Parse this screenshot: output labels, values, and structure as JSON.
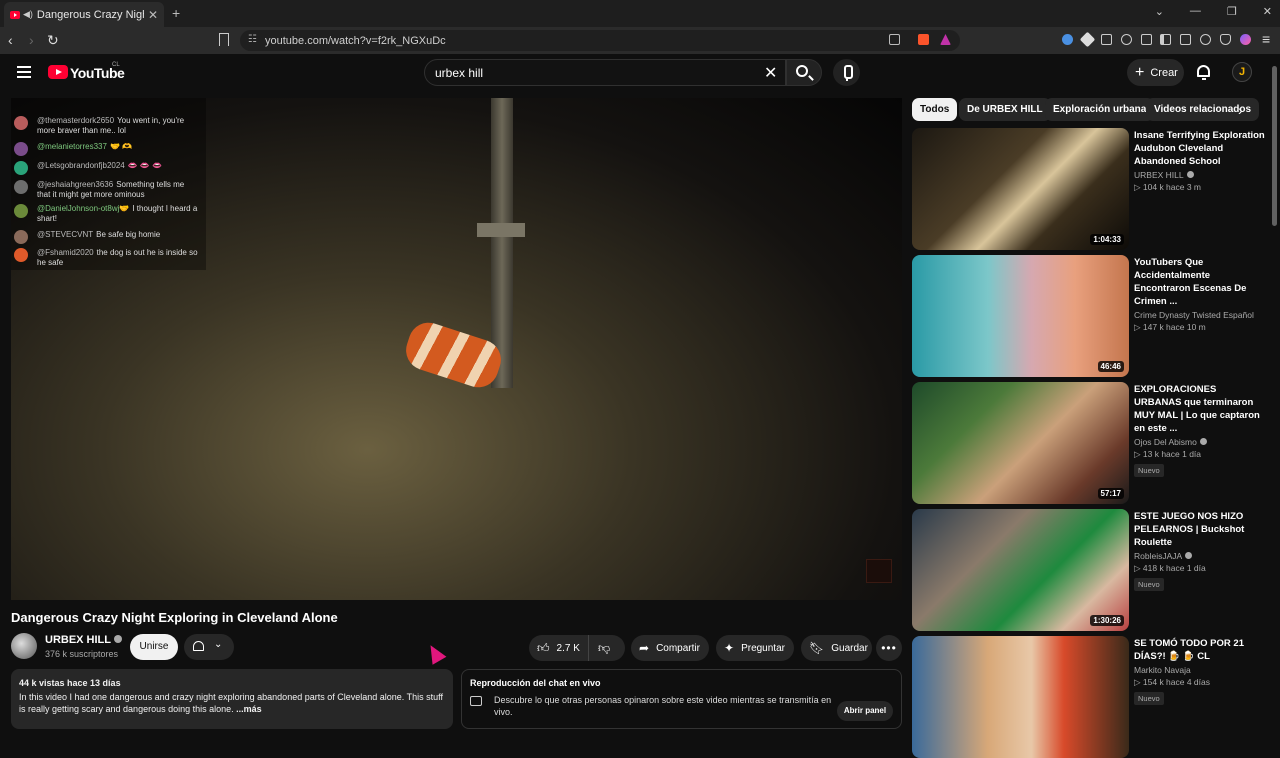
{
  "browser": {
    "tab_title": "Dangerous Crazy Night Exploring",
    "url": "youtube.com/watch?v=f2rk_NGXuDc"
  },
  "header": {
    "logo_text": "YouTube",
    "country_code": "CL",
    "search_value": "urbex hill",
    "create_label": "Crear",
    "avatar_letter": "J"
  },
  "overlay_chat": [
    {
      "user": "@themasterdork2650",
      "text": "You went in, you're more braver than me.. lol",
      "color": "#b85c5c"
    },
    {
      "user": "@melanietorres337",
      "text": "🤝 🫶",
      "color": "#7a4c8a",
      "green": true
    },
    {
      "user": "@Letsgobrandonfjb2024",
      "text": "👄 👄 👄",
      "color": "#2aa37a"
    },
    {
      "user": "@jeshaiahgreen3636",
      "text": "Something tells me that it might get more ominous",
      "color": "#6d6d6d"
    },
    {
      "user": "@DanielJohnson-ot8wj🤝",
      "text": "I thought I heard a shart!",
      "color": "#6b8a3a",
      "green": true
    },
    {
      "user": "@STEVECVNT",
      "text": "Be safe big homie",
      "color": "#8a6a5a"
    },
    {
      "user": "@Fshamid2020",
      "text": "the dog is out he is inside so he safe",
      "color": "#e05a2a"
    }
  ],
  "video": {
    "title": "Dangerous Crazy Night Exploring in Cleveland Alone",
    "channel": "URBEX HILL",
    "subs": "376 k suscriptores",
    "join_label": "Unirse",
    "likes": "2.7 K",
    "share_label": "Compartir",
    "ask_label": "Preguntar",
    "save_label": "Guardar",
    "views_date": "44 k vistas  hace 13 días",
    "description": "In this video I had one dangerous and crazy night exploring abandoned parts of Cleveland alone. This stuff is really getting scary and dangerous doing this alone.",
    "more_label": "...más"
  },
  "live_chat": {
    "heading": "Reproducción del chat en vivo",
    "text": "Descubre lo que otras personas opinaron sobre este video mientras se transmitía en vivo.",
    "button": "Abrir panel"
  },
  "chips": [
    "Todos",
    "De URBEX HILL",
    "Exploración urbana",
    "Videos relacionados"
  ],
  "recommendations": [
    {
      "title": "Insane Terrifying Exploration Audubon Cleveland Abandoned School",
      "channel": "URBEX HILL",
      "verified": true,
      "meta": "▷ 104 k  hace 3 m",
      "duration": "1:04:33",
      "badge": ""
    },
    {
      "title": "YouTubers Que Accidentalmente Encontraron Escenas De Crimen ...",
      "channel": "Crime Dynasty Twisted Español",
      "verified": false,
      "meta": "▷ 147 k  hace 10 m",
      "duration": "46:46",
      "badge": ""
    },
    {
      "title": "EXPLORACIONES URBANAS que terminaron MUY MAL | Lo que captaron en este ...",
      "channel": "Ojos Del Abismo",
      "verified": true,
      "meta": "▷ 13 k  hace 1 día",
      "duration": "57:17",
      "badge": "Nuevo"
    },
    {
      "title": "ESTE JUEGO NOS HIZO PELEARNOS | Buckshot Roulette",
      "channel": "RobleisJAJA",
      "verified": true,
      "meta": "▷ 418 k  hace 1 día",
      "duration": "1:30:26",
      "badge": "Nuevo"
    },
    {
      "title": "SE TOMÓ TODO POR 21 DÍAS?! 🍺 🍺 CL",
      "channel": "Markito Navaja",
      "verified": false,
      "meta": "▷ 154 k  hace 4 días",
      "duration": "",
      "badge": "Nuevo"
    }
  ]
}
